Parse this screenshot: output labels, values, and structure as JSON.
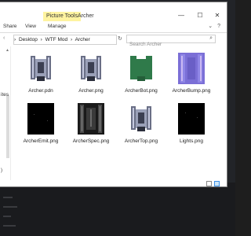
{
  "window": {
    "title": "Archer",
    "contextual_tab": "Picture Tools",
    "controls": {
      "minimize": "—",
      "maximize": "☐",
      "close": "✕"
    }
  },
  "ribbon": {
    "tabs": [
      "Share",
      "View",
      "Manage"
    ],
    "expand": "⌄",
    "help": "?"
  },
  "address": {
    "back": "‹",
    "sep": "›",
    "crumbs": [
      "Desktop",
      "WTF Mod",
      "Archer"
    ],
    "dropdown": "⌄",
    "refresh": "↻"
  },
  "search": {
    "placeholder": "Search Archer",
    "icon": "⌕"
  },
  "navpane": {
    "label": "ites",
    "selected": ")"
  },
  "files": [
    {
      "name": "Archer.pdn",
      "thumb": "archer-gray"
    },
    {
      "name": "Archer.png",
      "thumb": "archer-gray"
    },
    {
      "name": "ArcherBot.png",
      "thumb": "archer-green"
    },
    {
      "name": "ArcherBump.png",
      "thumb": "archer-bump"
    },
    {
      "name": "ArcherEmit.png",
      "thumb": "black"
    },
    {
      "name": "ArcherSpec.png",
      "thumb": "spec"
    },
    {
      "name": "ArcherTop.png",
      "thumb": "archer-gray"
    },
    {
      "name": "Lights.png",
      "thumb": "black"
    }
  ],
  "colors": {
    "picture_tools": "#fef3a0",
    "bot_green": "#2f7a4a",
    "bump_purple": "#7b6fd6",
    "selection_blue": "#3a8ee6"
  }
}
